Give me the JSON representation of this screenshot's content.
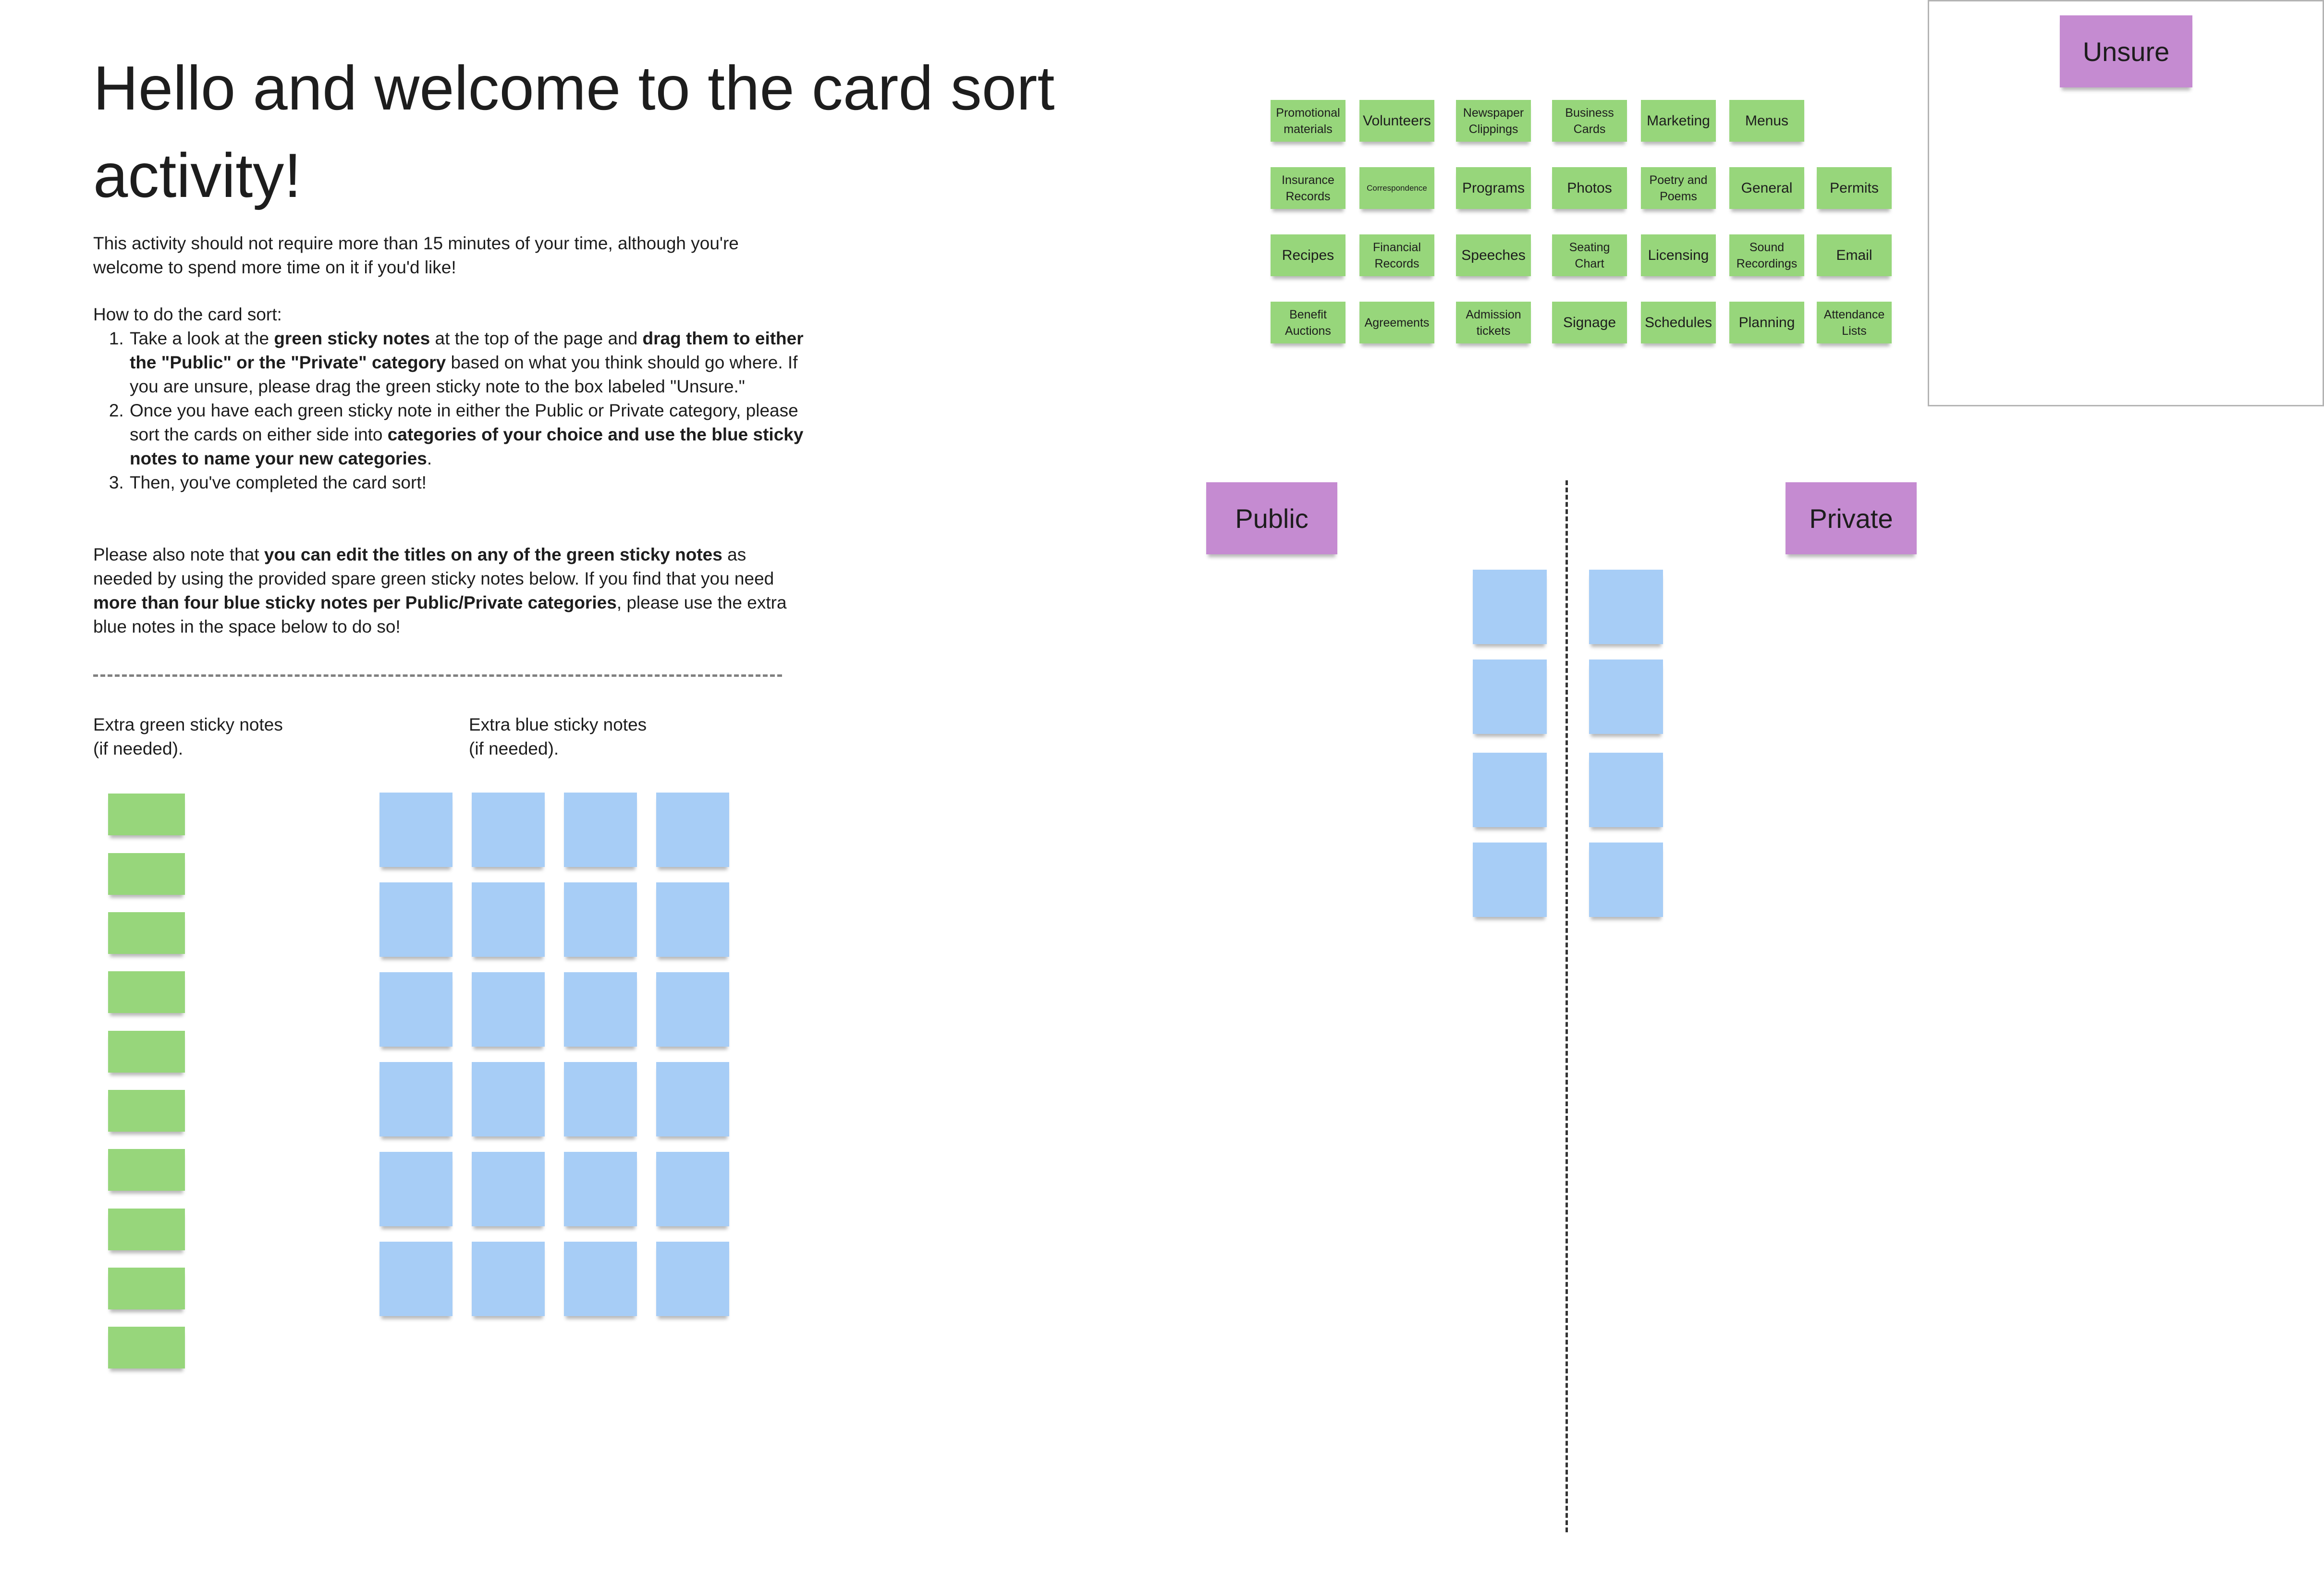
{
  "title": "Hello and welcome to the card sort activity!",
  "intro": "This activity should not require more than 15 minutes of your time, although you're welcome to spend more time on it if you'd like!",
  "how_to_heading": "How to do the card sort:",
  "steps": {
    "s1": {
      "a": "Take a look at the ",
      "b": "green sticky notes",
      "c": " at the top of the page and ",
      "d": "drag them to either the \"Public\" or the \"Private\" category",
      "e": " based on what you think should go where. If you are unsure, please drag the green sticky note to the box labeled \"Unsure.\""
    },
    "s2": {
      "a": "Once you have each green sticky note in either the Public or Private category, please sort the cards on either side into ",
      "b": "categories of your choice and use the blue sticky notes to name your new categories",
      "c": "."
    },
    "s3": "Then, you've completed the card sort!"
  },
  "note": {
    "a": "Please also note that ",
    "b": "you can edit the titles on any of the green sticky notes",
    "c": " as needed by using the provided spare green sticky notes below.  If you find that you need ",
    "d": "more than four blue sticky notes per Public/Private categories",
    "e": ", please use the extra blue notes in the space below to do so!"
  },
  "extra_green_label": {
    "line1": "Extra green sticky notes",
    "line2": "(if needed)."
  },
  "extra_blue_label": {
    "line1": "Extra blue sticky notes",
    "line2": "(if needed)."
  },
  "categories": {
    "unsure": "Unsure",
    "public": "Public",
    "private": "Private"
  },
  "cards": [
    [
      "Promotional materials",
      "Volunteers",
      "Newspaper Clippings",
      "Business Cards",
      "Marketing",
      "Menus",
      ""
    ],
    [
      "Insurance Records",
      "Correspondence",
      "Programs",
      "Photos",
      "Poetry and Poems",
      "General",
      "Permits"
    ],
    [
      "Recipes",
      "Financial Records",
      "Speeches",
      "Seating Chart",
      "Licensing",
      "Sound Recordings",
      "Email"
    ],
    [
      "Benefit Auctions",
      "Agreements",
      "Admission tickets",
      "Signage",
      "Schedules",
      "Planning",
      "Attendance Lists"
    ]
  ],
  "colors": {
    "green_note": "#97d67b",
    "blue_note": "#a7cdf6",
    "category_note": "#c58bd1"
  }
}
